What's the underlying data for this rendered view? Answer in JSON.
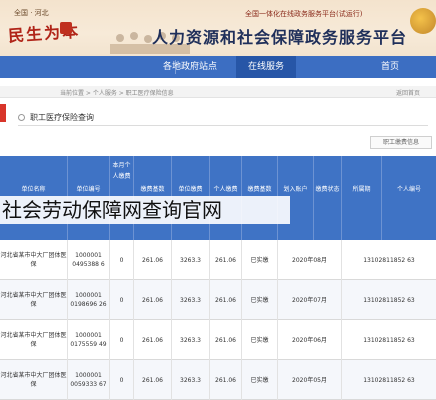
{
  "header": {
    "location": "全国 · 河北",
    "brush_text": "民生为本",
    "subtitle": "全国一体化在线政务服务平台(试运行)",
    "site_name": "人力资源和社会保障政务服务平台"
  },
  "nav": {
    "items": [
      {
        "label": "在线服务",
        "active": true
      },
      {
        "label": "各地政府站点",
        "active": false
      },
      {
        "label": "首页",
        "active": false
      }
    ]
  },
  "breadcrumb": {
    "text": "当前位置 > 个人服务 > 职工医疗保险信息",
    "right": "返回首页"
  },
  "section": {
    "title": "职工医疗保险查询"
  },
  "tab_label": "职工缴费信息",
  "table": {
    "headers": [
      "单位名称",
      "单位编号",
      "本月个人缴费",
      "缴费基数",
      "单位缴费",
      "个人缴费",
      "缴费基数",
      "划入账户",
      "缴费状态",
      "所属期",
      "个人编号"
    ],
    "rows": [
      {
        "unit_name": "河北省某市中大厂团体医保",
        "unit_no": "1000001 0495388 6",
        "flag": "0",
        "base": "261.06",
        "unit_pay": "3263.3",
        "person_pay": "261.06",
        "status": "已实缴",
        "period": "2020年08月",
        "person_no": "13102811852 63"
      },
      {
        "unit_name": "河北省某市中大厂团体医保",
        "unit_no": "1000001 0198696 26",
        "flag": "0",
        "base": "261.06",
        "unit_pay": "3263.3",
        "person_pay": "261.06",
        "status": "已实缴",
        "period": "2020年07月",
        "person_no": "13102811852 63"
      },
      {
        "unit_name": "河北省某市中大厂团体医保",
        "unit_no": "1000001 0175559 49",
        "flag": "0",
        "base": "261.06",
        "unit_pay": "3263.3",
        "person_pay": "261.06",
        "status": "已实缴",
        "period": "2020年06月",
        "person_no": "13102811852 63"
      },
      {
        "unit_name": "河北省某市中大厂团体医保",
        "unit_no": "1000001 0059333 67",
        "flag": "0",
        "base": "261.06",
        "unit_pay": "3263.3",
        "person_pay": "261.06",
        "status": "已实缴",
        "period": "2020年05月",
        "person_no": "13102811852 63"
      }
    ]
  },
  "overlay_caption": "社会劳动保障网查询官网"
}
